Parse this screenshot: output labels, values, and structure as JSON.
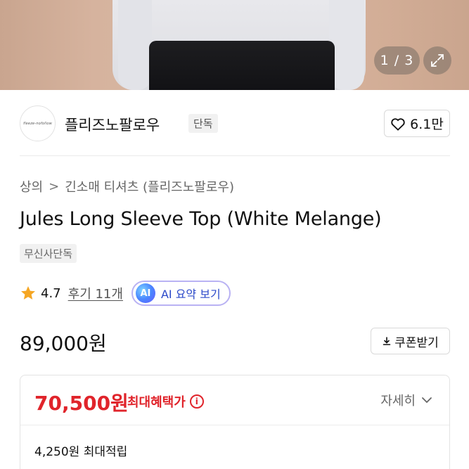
{
  "hero": {
    "pager": "1 / 3",
    "expand_icon": "expand-icon"
  },
  "brand": {
    "logo_text": "fleeze-nofollow",
    "name": "플리즈노팔로우",
    "tag": "단독",
    "likes": "6.1만",
    "like_icon": "heart-icon"
  },
  "breadcrumb": {
    "level1": "상의",
    "separator": ">",
    "level2": "긴소매 티셔츠 (플리즈노팔로우)"
  },
  "product": {
    "title": "Jules Long Sleeve Top (White Melange)",
    "badge": "무신사단독"
  },
  "rating": {
    "score": "4.7",
    "reviews": "후기 11개",
    "ai_badge": "AI",
    "ai_label": "AI 요약 보기"
  },
  "price": {
    "original": "89,000원",
    "coupon_label": "쿠폰받기"
  },
  "benefit": {
    "price": "70,500원",
    "label": "최대혜택가",
    "info_icon": "info-icon",
    "detail": "자세히",
    "points": "4,250원 최대적립"
  },
  "colors": {
    "accent_red": "#e0242b",
    "ai_blue": "#2b49c9",
    "star": "#f5a623"
  }
}
